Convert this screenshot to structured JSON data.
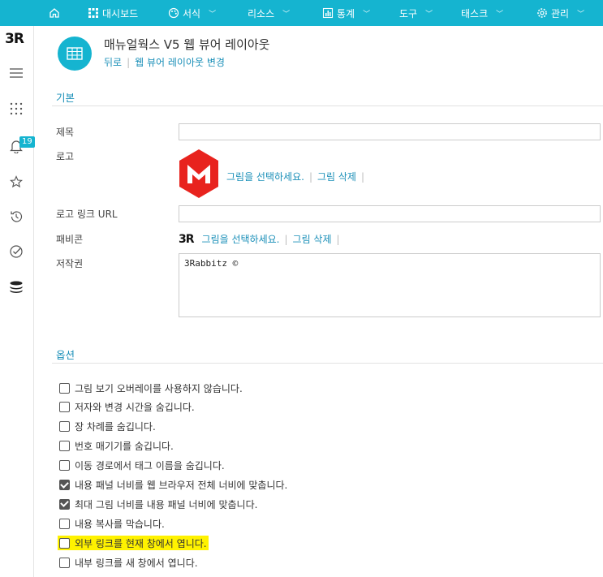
{
  "nav": {
    "dashboard": "대시보드",
    "format": "서식",
    "resources": "리소스",
    "stats": "통계",
    "tools": "도구",
    "tasks": "태스크",
    "admin": "관리"
  },
  "sidebar": {
    "logo": "3R",
    "notification_count": "19"
  },
  "header": {
    "title": "매뉴얼웍스 V5 웹 뷰어 레이아웃",
    "back": "뒤로",
    "action": "웹 뷰어 레이아웃 변경"
  },
  "sections": {
    "basic": "기본",
    "options": "옵션"
  },
  "fields": {
    "title_label": "제목",
    "title_value": "",
    "logo_label": "로고",
    "logo_link_label": "로고 링크 URL",
    "logo_link_value": "",
    "favicon_label": "패비콘",
    "copyright_label": "저작권",
    "copyright_value": "3Rabbitz ©",
    "select_image": "그림을 선택하세요.",
    "delete_image": "그림 삭제",
    "favicon_logo": "3R"
  },
  "options": [
    {
      "label": "그림 보기 오버레이를 사용하지 않습니다.",
      "checked": false
    },
    {
      "label": "저자와 변경 시간을 숨깁니다.",
      "checked": false
    },
    {
      "label": "장 차례를 숨깁니다.",
      "checked": false
    },
    {
      "label": "번호 매기기를 숨깁니다.",
      "checked": false
    },
    {
      "label": "이동 경로에서 태그 이름을 숨깁니다.",
      "checked": false
    },
    {
      "label": "내용 패널 너비를 웹 브라우저 전체 너비에 맞춥니다.",
      "checked": true
    },
    {
      "label": "최대 그림 너비를 내용 패널 너비에 맞춥니다.",
      "checked": true
    },
    {
      "label": "내용 복사를 막습니다.",
      "checked": false
    },
    {
      "label": "외부 링크를 현재 창에서 엽니다.",
      "checked": false,
      "highlighted": true
    },
    {
      "label": "내부 링크를 새 창에서 엽니다.",
      "checked": false
    }
  ],
  "colors": {
    "accent": "#15b4d0",
    "link": "#1a8fb8",
    "logo_red": "#e8231e",
    "highlight": "#fff200"
  }
}
